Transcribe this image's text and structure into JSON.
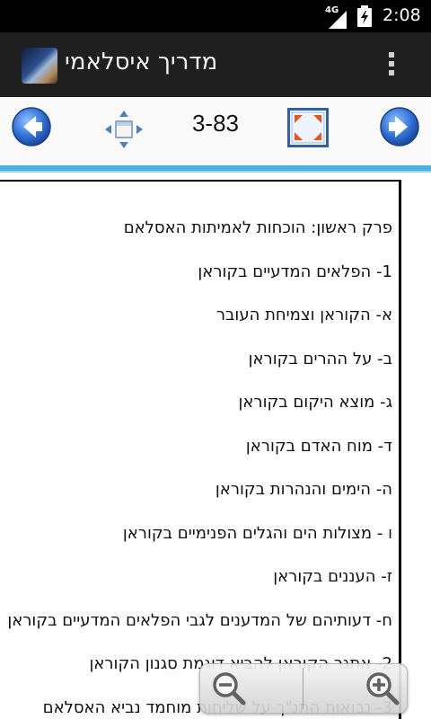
{
  "status_bar": {
    "network": "4G",
    "time": "2:08"
  },
  "action_bar": {
    "title": "מדריך איסלאמי"
  },
  "toolbar": {
    "page_indicator": "3-83"
  },
  "content": {
    "items": [
      "פרק ראשון: הוכחות לאמיתות האסלאם",
      "1- הפלאים המדעיים בקוראן",
      "א- הקוראן וצמיחת העובר",
      "ב- על ההרים בקוראן",
      "ג- מוצא היקום בקוראן",
      "ד- מוח האדם בקוראן",
      "ה- הימים והנהרות בקוראן",
      "ו - מצולות הים והגלים הפנימיים בקוראן",
      "ז- העננים בקוראן",
      "ח- דעותיהם של המדענים לגבי הפלאים המדעיים בקוראן",
      "2- אתגר הקוראן להביא דוגמת סגנון הקוראן",
      "3- נבואות התנ\"ך על שליחות מוחמד נביא האסלאם"
    ]
  },
  "colors": {
    "action_bar": "#1f1f1f",
    "accent_line": "#49b3dd",
    "nav_arrow": "#2f6fd6"
  },
  "icons": {
    "prev": "arrow-left-icon",
    "move": "move-arrows-icon",
    "fullscreen": "fullscreen-icon",
    "next": "arrow-right-icon",
    "zoom_out": "zoom-out-icon",
    "zoom_in": "zoom-in-icon"
  }
}
